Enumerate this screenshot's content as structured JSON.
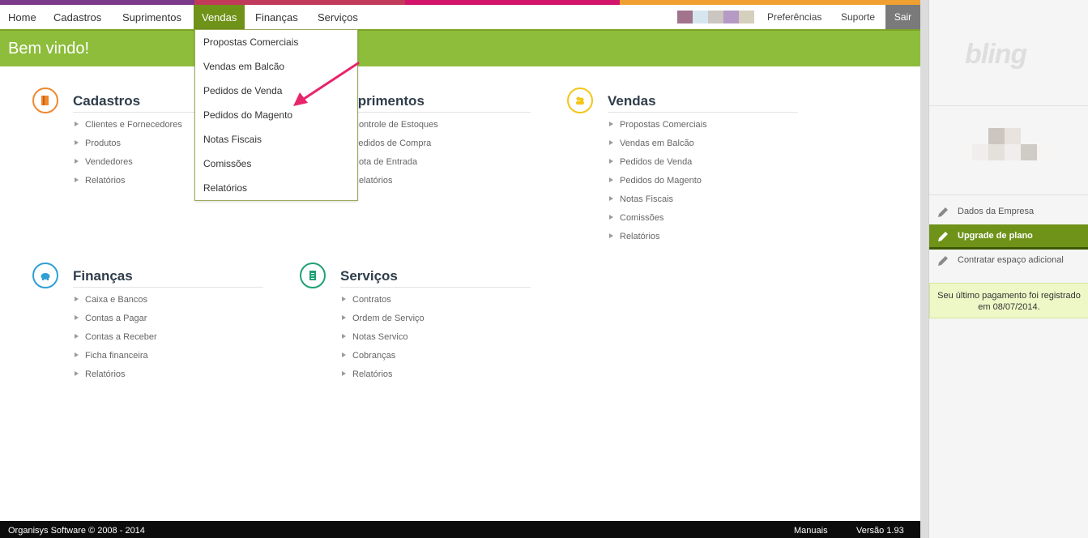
{
  "colors": {
    "stripe": [
      "#7b3a8a",
      "#c23a5a",
      "#d2156a",
      "#f0a030"
    ],
    "swatches": [
      "#a1738c",
      "#d5e6ef",
      "#cbc6c0",
      "#b49ac4",
      "#d5cfbd"
    ],
    "accent": "#8dbd3b",
    "accent_dark": "#6f9219"
  },
  "topnav": {
    "items": [
      "Home",
      "Cadastros",
      "Suprimentos",
      "Vendas",
      "Finanças",
      "Serviços"
    ],
    "preferences": "Preferências",
    "support": "Suporte",
    "logout": "Sair"
  },
  "welcome": "Bem vindo!",
  "dropdown": {
    "items": [
      "Propostas Comerciais",
      "Vendas em Balcão",
      "Pedidos de Venda",
      "Pedidos do Magento",
      "Notas Fiscais",
      "Comissões",
      "Relatórios"
    ]
  },
  "sections": [
    {
      "title": "Cadastros",
      "icon": "book-icon",
      "color": "#f0882e",
      "items": [
        "Clientes e Fornecedores",
        "Produtos",
        "Vendedores",
        "Relatórios"
      ]
    },
    {
      "title": "Suprimentos",
      "icon": "box-icon",
      "color": "#3a7abf",
      "items": [
        "Controle de Estoques",
        "Pedidos de Compra",
        "Nota de Entrada",
        "Relatórios"
      ]
    },
    {
      "title": "Vendas",
      "icon": "users-icon",
      "color": "#f5c518",
      "items": [
        "Propostas Comerciais",
        "Vendas em Balcão",
        "Pedidos de Venda",
        "Pedidos do Magento",
        "Notas Fiscais",
        "Comissões",
        "Relatórios"
      ]
    },
    {
      "title": "Finanças",
      "icon": "piggy-bank-icon",
      "color": "#2f9fd8",
      "items": [
        "Caixa e Bancos",
        "Contas a Pagar",
        "Contas a Receber",
        "Ficha financeira",
        "Relatórios"
      ]
    },
    {
      "title": "Serviços",
      "icon": "document-icon",
      "color": "#1fa174",
      "items": [
        "Contratos",
        "Ordem de Serviço",
        "Notas Servico",
        "Cobranças",
        "Relatórios"
      ]
    }
  ],
  "sidebar": {
    "logo": "bling",
    "links": [
      {
        "label": "Dados da Empresa",
        "icon": "pencil-icon"
      },
      {
        "label": "Upgrade de plano",
        "icon": "pencil-icon"
      },
      {
        "label": "Contratar espaço adicional",
        "icon": "pencil-icon"
      }
    ],
    "payment_line1": "Seu último pagamento foi registrado",
    "payment_line2": "em 08/07/2014."
  },
  "footer": {
    "copyright": "Organisys Software © 2008 - 2014",
    "manuals": "Manuais",
    "version": "Versão 1.93"
  }
}
